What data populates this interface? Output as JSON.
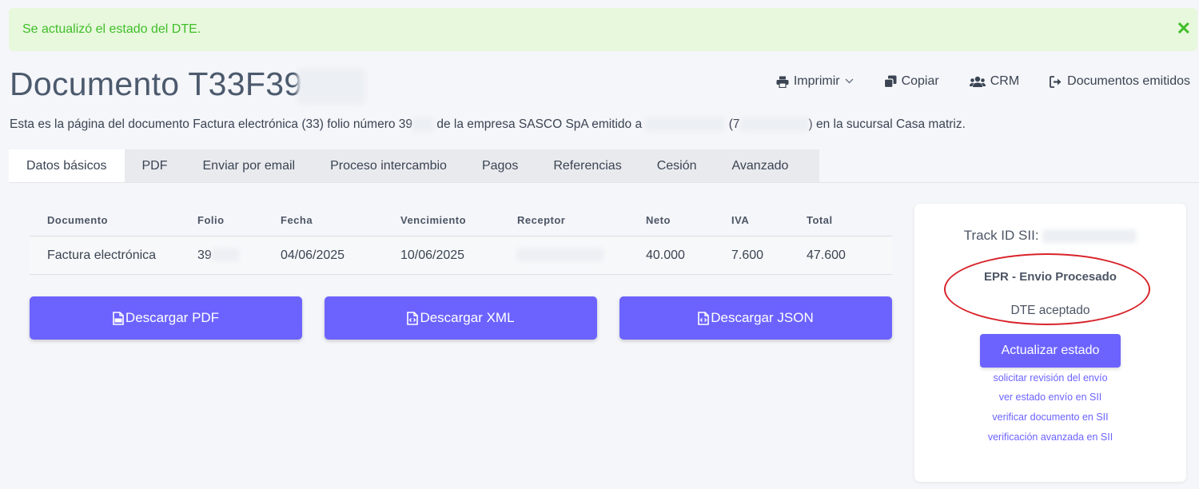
{
  "alert": {
    "message": "Se actualizó el estado del DTE.",
    "close": "✕"
  },
  "page": {
    "title": "Documento T33F39",
    "description_parts": [
      "Esta es la página del documento Factura electrónica (33) folio número 39",
      "de la empresa SASCO SpA emitido a",
      "(7",
      ") en la sucursal Casa matriz."
    ]
  },
  "actions": [
    {
      "label": "Imprimir",
      "icon": "print-icon"
    },
    {
      "label": "Copiar",
      "icon": "copy-icon"
    },
    {
      "label": "CRM",
      "icon": "users-icon"
    },
    {
      "label": "Documentos emitidos",
      "icon": "sign-out-icon"
    }
  ],
  "tabs": [
    "Datos básicos",
    "PDF",
    "Enviar por email",
    "Proceso intercambio",
    "Pagos",
    "Referencias",
    "Cesión",
    "Avanzado"
  ],
  "table": {
    "headers": [
      "Documento",
      "Folio",
      "Fecha",
      "Vencimiento",
      "Receptor",
      "Neto",
      "IVA",
      "Total"
    ],
    "row": [
      "Factura electrónica",
      "39",
      "04/06/2025",
      "10/06/2025",
      "",
      "40.000",
      "7.600",
      "47.600"
    ]
  },
  "downloads": [
    {
      "label": "Descargar PDF",
      "icon": "file-pdf-icon"
    },
    {
      "label": "Descargar XML",
      "icon": "file-code-icon"
    },
    {
      "label": "Descargar JSON",
      "icon": "file-code-icon"
    }
  ],
  "status_card": {
    "track_label": "Track ID SII:",
    "status": "EPR - Envio Procesado",
    "detail": "DTE aceptado",
    "update_button": "Actualizar estado",
    "links": [
      "solicitar revisión del envío",
      "ver estado envío en SII",
      "verificar documento en SII",
      "verificación avanzada en SII"
    ]
  },
  "colors": {
    "accent": "#6c63ff",
    "success_text": "#3fbe29",
    "success_bg": "#e7f8dc",
    "annotation": "#d8232a"
  }
}
